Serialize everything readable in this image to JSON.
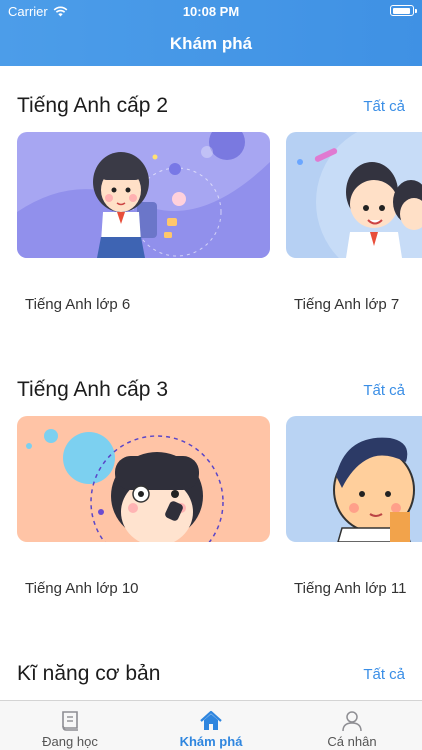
{
  "status": {
    "carrier": "Carrier",
    "time": "10:08 PM"
  },
  "header": {
    "title": "Khám phá"
  },
  "sections": [
    {
      "title": "Tiếng Anh cấp 2",
      "see_all": "Tất cả",
      "cards": [
        {
          "label": "Tiếng Anh lớp 6"
        },
        {
          "label": "Tiếng Anh lớp 7"
        }
      ]
    },
    {
      "title": "Tiếng Anh cấp 3",
      "see_all": "Tất cả",
      "cards": [
        {
          "label": "Tiếng Anh lớp 10"
        },
        {
          "label": "Tiếng Anh lớp 11"
        }
      ]
    },
    {
      "title": "Kĩ năng cơ bản",
      "see_all": "Tất cả",
      "cards": []
    }
  ],
  "tabs": [
    {
      "label": "Đang học",
      "icon": "book-icon",
      "active": false
    },
    {
      "label": "Khám phá",
      "icon": "home-icon",
      "active": true
    },
    {
      "label": "Cá nhân",
      "icon": "person-icon",
      "active": false
    }
  ],
  "colors": {
    "header": "#4097e6",
    "accent": "#3a8ee6",
    "tab_inactive": "#8e8e93"
  }
}
